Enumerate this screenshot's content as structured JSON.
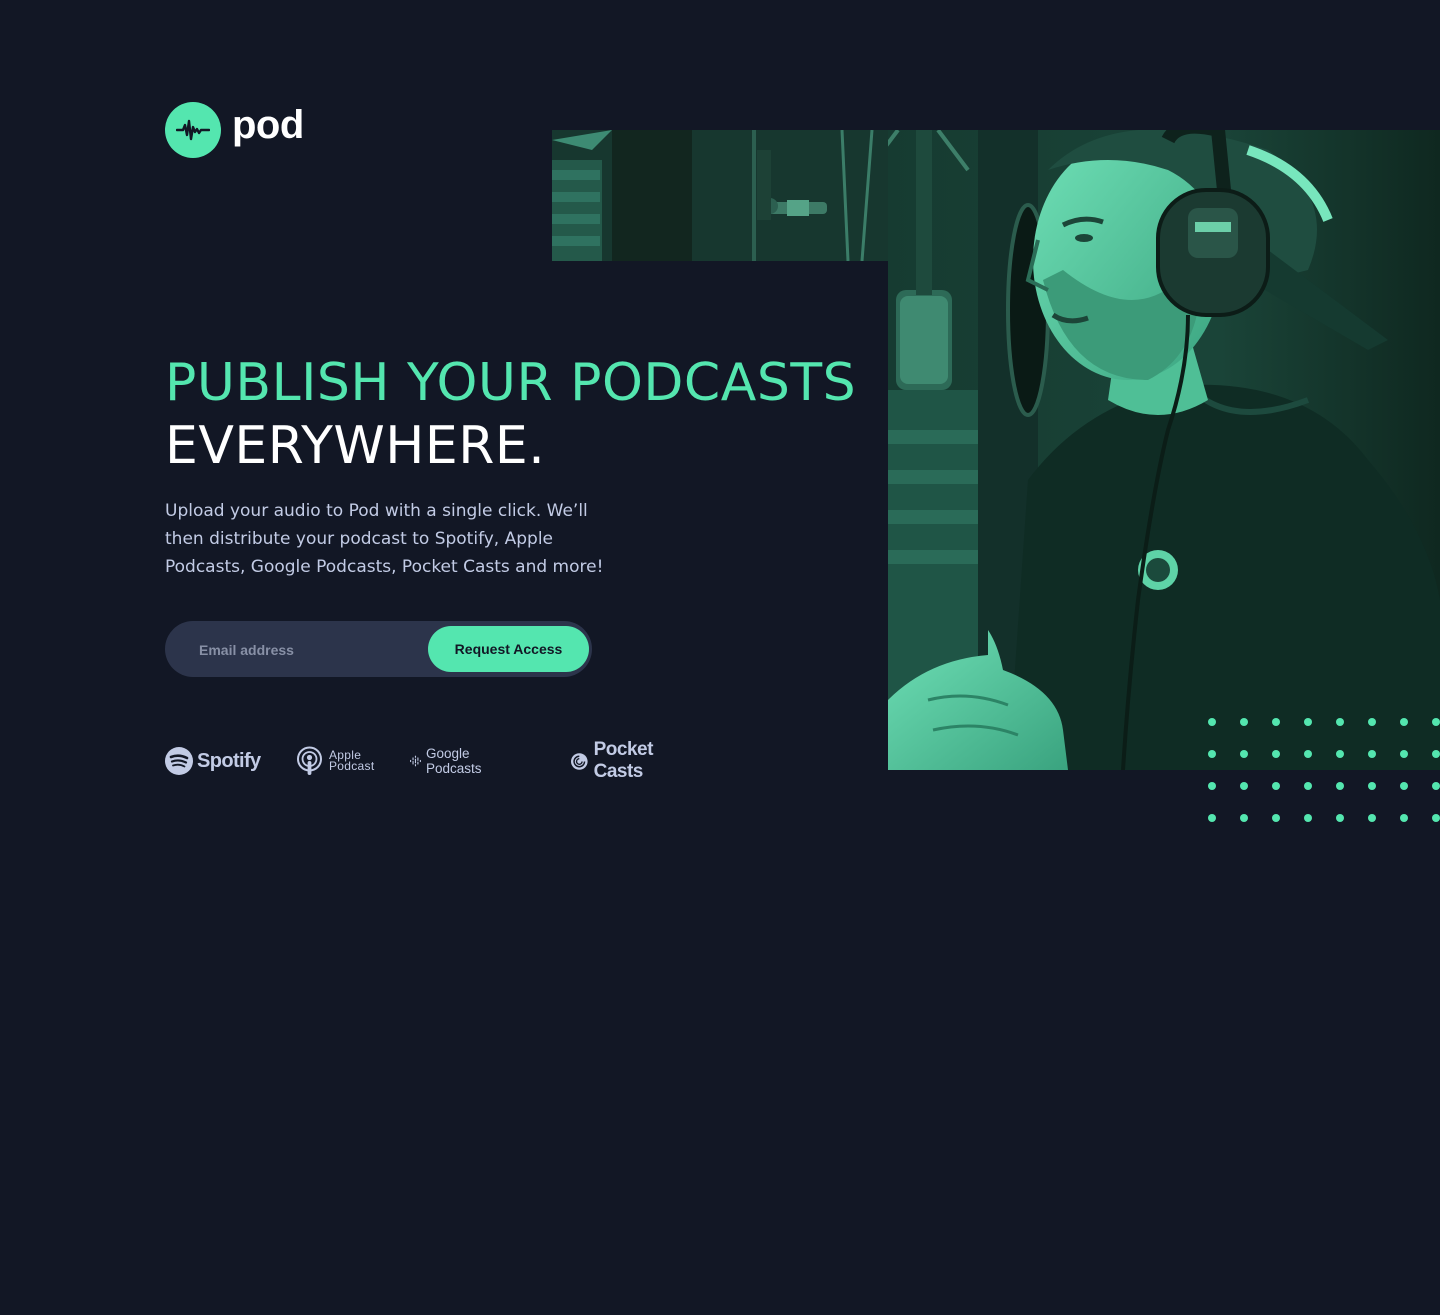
{
  "brand": {
    "logo_text": "pod",
    "accent_color": "#54e6af",
    "background_color": "#121725",
    "logo_icon": "waveform-icon"
  },
  "hero": {
    "headline_line1": "PUBLISH YOUR PODCASTS",
    "headline_line2": "EVERYWHERE.",
    "description": "Upload your audio to Pod with a single click. We’ll then distribute your podcast to Spotify, Apple Podcasts, Google Podcasts, Pocket Casts and more!",
    "image": "podcaster-with-microphone-photo"
  },
  "form": {
    "email_placeholder": "Email address",
    "email_value": "",
    "submit_label": "Request Access"
  },
  "platforms": [
    {
      "name": "Spotify",
      "icon": "spotify-icon"
    },
    {
      "name_line1": "Apple",
      "name_line2": "Podcast",
      "icon": "apple-podcast-icon"
    },
    {
      "name": "Google Podcasts",
      "icon": "google-podcasts-icon"
    },
    {
      "name": "Pocket Casts",
      "icon": "pocket-casts-icon"
    }
  ]
}
